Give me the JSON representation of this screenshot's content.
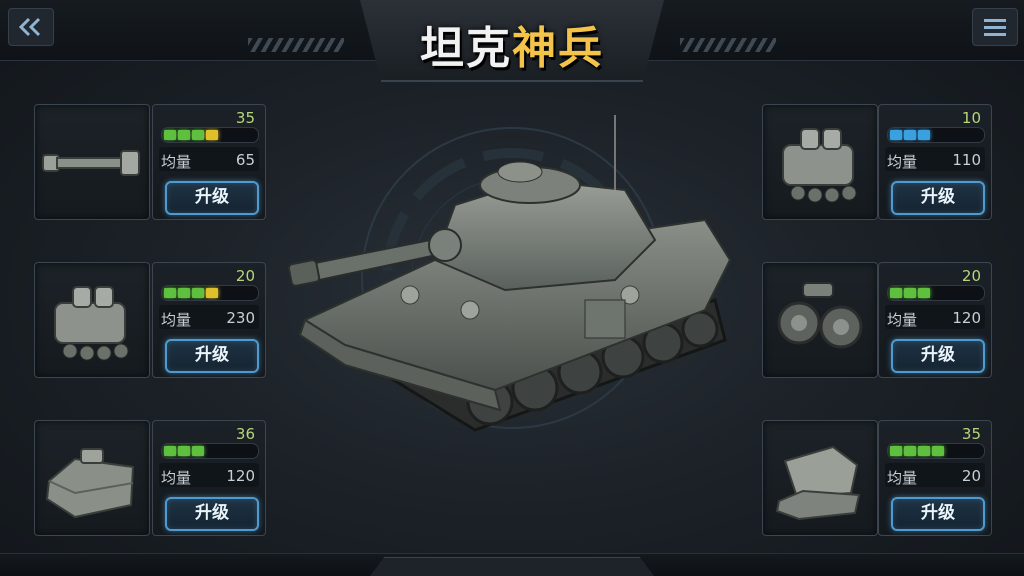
{
  "title": {
    "part1": "坦克",
    "part2": "神兵"
  },
  "nav": {
    "back_icon": "double-chevron-left-icon",
    "menu_icon": "hamburger-menu-icon"
  },
  "colors": {
    "accent": "#4f9bd0",
    "title_gold": "#f3c34a",
    "bar_green": "#5fbf3f",
    "bar_yellow": "#e0c02a",
    "bar_blue": "#3aa0e0"
  },
  "left_parts": [
    {
      "icon": "cannon-barrel-icon",
      "level": "35",
      "stat_label": "均量",
      "stat_value": "65",
      "progress": 0.55,
      "bar_color": "green-yellow",
      "button": "升级"
    },
    {
      "icon": "engine-icon",
      "level": "20",
      "stat_label": "均量",
      "stat_value": "230",
      "progress": 0.5,
      "bar_color": "green-yellow",
      "button": "升级"
    },
    {
      "icon": "armor-plate-icon",
      "level": "36",
      "stat_label": "均量",
      "stat_value": "120",
      "progress": 0.45,
      "bar_color": "green",
      "button": "升级"
    }
  ],
  "right_parts": [
    {
      "icon": "engine-icon",
      "level": "10",
      "stat_label": "均量",
      "stat_value": "110",
      "progress": 0.45,
      "bar_color": "blue",
      "button": "升级"
    },
    {
      "icon": "track-wheels-icon",
      "level": "20",
      "stat_label": "均量",
      "stat_value": "120",
      "progress": 0.4,
      "bar_color": "green",
      "button": "升级"
    },
    {
      "icon": "turret-armor-icon",
      "level": "35",
      "stat_label": "均量",
      "stat_value": "20",
      "progress": 0.5,
      "bar_color": "green",
      "button": "升级"
    }
  ]
}
